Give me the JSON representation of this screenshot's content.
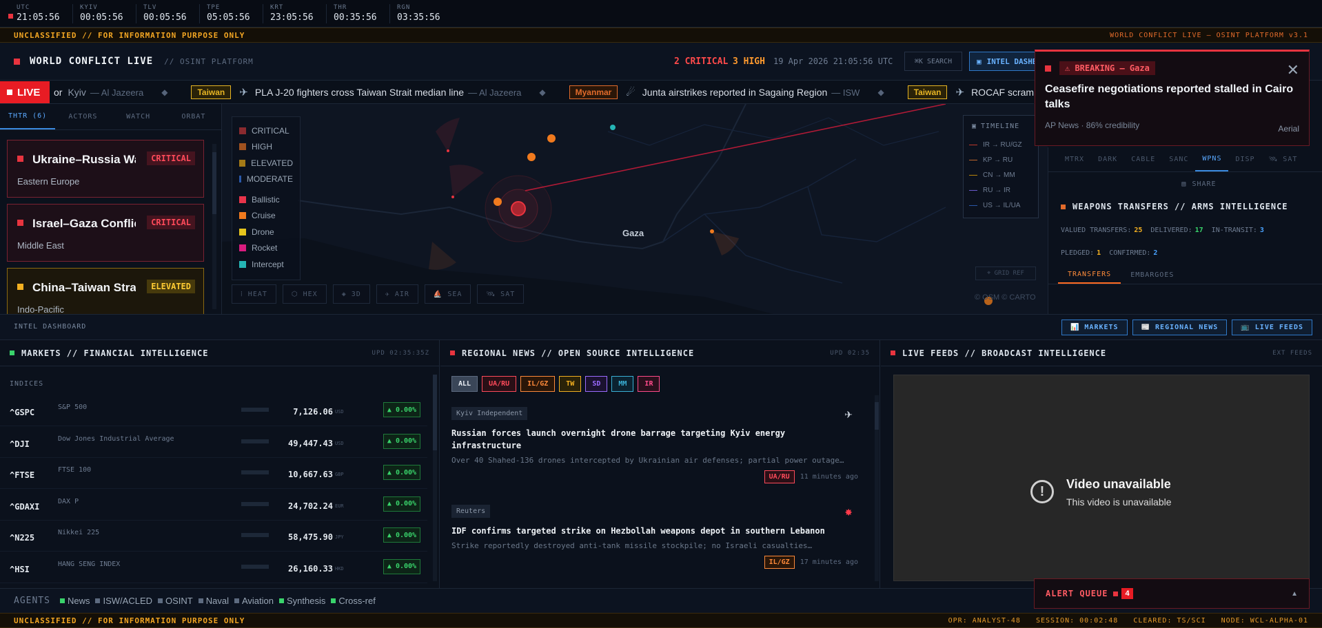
{
  "clock": [
    {
      "zone": "UTC",
      "time": "21:05:56"
    },
    {
      "zone": "KYIV",
      "time": "00:05:56"
    },
    {
      "zone": "TLV",
      "time": "00:05:56"
    },
    {
      "zone": "TPE",
      "time": "05:05:56"
    },
    {
      "zone": "KRT",
      "time": "23:05:56"
    },
    {
      "zone": "THR",
      "time": "00:35:56"
    },
    {
      "zone": "RGN",
      "time": "03:35:56"
    }
  ],
  "classification": {
    "banner": "UNCLASSIFIED // FOR INFORMATION PURPOSE ONLY",
    "platform": "WORLD CONFLICT LIVE — OSINT PLATFORM v3.1"
  },
  "header": {
    "brand": "WORLD CONFLICT LIVE",
    "subtitle": "// OSINT PLATFORM",
    "critical": "2 CRITICAL",
    "high": "3 HIGH",
    "datetime": "19 Apr 2026 21:05:56 UTC",
    "search": "⌘K SEARCH",
    "intel": "INTEL DASHBOARD"
  },
  "ticker": {
    "live": "LIVE",
    "items": [
      {
        "tag": "",
        "headline": "or",
        "extra": "Kyiv",
        "source": "— Al Jazeera",
        "icon": "",
        "color": ""
      },
      {
        "tag": "Taiwan",
        "headline": "PLA J-20 fighters cross Taiwan Strait median line",
        "source": "— Al Jazeera",
        "icon": "✈",
        "color": "#e7b524"
      },
      {
        "tag": "Myanmar",
        "headline": "Junta airstrikes reported in Sagaing Region",
        "source": "— ISW",
        "icon": "☄",
        "color": "#e26b2b"
      },
      {
        "tag": "Taiwan",
        "headline": "ROCAF scrambles jets",
        "source": "",
        "icon": "✈",
        "color": "#e7b524"
      }
    ]
  },
  "left": {
    "tabs": [
      "THTR (6)",
      "ACTORS",
      "WATCH",
      "ORBAT"
    ],
    "cards": [
      {
        "title": "Ukraine–Russia War",
        "badge": "CRITICAL",
        "region": "Eastern Europe",
        "level": "crit"
      },
      {
        "title": "Israel–Gaza Conflict",
        "badge": "CRITICAL",
        "region": "Middle East",
        "level": "crit"
      },
      {
        "title": "China–Taiwan Strait",
        "badge": "ELEVATED",
        "region": "Indo-Pacific",
        "level": "elev"
      }
    ]
  },
  "map": {
    "legend": [
      {
        "label": "CRITICAL",
        "color": "#8a2a2f"
      },
      {
        "label": "HIGH",
        "color": "#a0521f"
      },
      {
        "label": "ELEVATED",
        "color": "#a47a16"
      },
      {
        "label": "MODERATE",
        "color": "#2a58a8"
      },
      {
        "label": "Ballistic",
        "color": "#e8344a"
      },
      {
        "label": "Cruise",
        "color": "#f07a1e"
      },
      {
        "label": "Drone",
        "color": "#e6c51d"
      },
      {
        "label": "Rocket",
        "color": "#d91c7f"
      },
      {
        "label": "Intercept",
        "color": "#25b5b5"
      }
    ],
    "buttons": [
      "⁞ HEAT",
      "⬡ HEX",
      "◈ 3D",
      "✈ AIR",
      "⛵ SEA",
      "🛰 SAT"
    ],
    "place": "Gaza",
    "attribution": "© OSM © CARTO",
    "grid_ref": "⌖ GRID REF",
    "timeline": {
      "title": "TIMELINE",
      "items": [
        {
          "label": "IR → RU/GZ",
          "color": "#c0392b"
        },
        {
          "label": "KP → RU",
          "color": "#c0662b"
        },
        {
          "label": "CN → MM",
          "color": "#b8860b"
        },
        {
          "label": "RU → IR",
          "color": "#6a5acd"
        },
        {
          "label": "US → IL/UA",
          "color": "#2a58a8"
        }
      ]
    }
  },
  "breaking": {
    "label": "⚠ BREAKING — Gaza",
    "headline": "Ceasefire negotiations reported stalled in Cairo talks",
    "meta": "AP News · 86% credibility",
    "type": "Aerial"
  },
  "right": {
    "tabs": [
      "MTRX",
      "DARK",
      "CABLE",
      "SANC",
      "WPNS",
      "DISP",
      "🛰 SAT"
    ],
    "share": "SHARE",
    "title": "WEAPONS TRANSFERS // ARMS INTELLIGENCE",
    "stats": [
      {
        "label": "VALUED TRANSFERS:",
        "value": "25",
        "color": "#f3b021"
      },
      {
        "label": "DELIVERED:",
        "value": "17",
        "color": "#39d36b"
      },
      {
        "label": "IN-TRANSIT:",
        "value": "3",
        "color": "#4aa3ff"
      }
    ],
    "stats2": [
      {
        "label": "PLEDGED:",
        "value": "1",
        "color": "#f3b021"
      },
      {
        "label": "CONFIRMED:",
        "value": "2",
        "color": "#4aa3ff"
      }
    ],
    "subtabs": [
      "TRANSFERS",
      "EMBARGOES"
    ]
  },
  "dashboard": {
    "title": "INTEL DASHBOARD",
    "buttons": [
      "📊 MARKETS",
      "📰 REGIONAL NEWS",
      "📺 LIVE FEEDS"
    ]
  },
  "markets": {
    "title": "MARKETS // FINANCIAL INTELLIGENCE",
    "updated": "UPD 02:35:35Z",
    "section": "INDICES",
    "rows": [
      {
        "symbol": "^GSPC",
        "name": "S&P 500",
        "price": "7,126.06",
        "cur": "USD",
        "change": "▲ 0.00%"
      },
      {
        "symbol": "^DJI",
        "name": "Dow Jones Industrial Average",
        "price": "49,447.43",
        "cur": "USD",
        "change": "▲ 0.00%"
      },
      {
        "symbol": "^FTSE",
        "name": "FTSE 100",
        "price": "10,667.63",
        "cur": "GBP",
        "change": "▲ 0.00%"
      },
      {
        "symbol": "^GDAXI",
        "name": "DAX P",
        "price": "24,702.24",
        "cur": "EUR",
        "change": "▲ 0.00%"
      },
      {
        "symbol": "^N225",
        "name": "Nikkei 225",
        "price": "58,475.90",
        "cur": "JPY",
        "change": "▲ 0.00%"
      },
      {
        "symbol": "^HSI",
        "name": "HANG SENG INDEX",
        "price": "26,160.33",
        "cur": "HKD",
        "change": "▲ 0.00%"
      }
    ]
  },
  "news": {
    "title": "REGIONAL NEWS // OPEN SOURCE INTELLIGENCE",
    "updated": "UPD 02:35",
    "filters": [
      {
        "label": "ALL",
        "color": "#c8d1dd",
        "bg": "#3a4658"
      },
      {
        "label": "UA/RU",
        "color": "#ff4a5a",
        "bg": "#2a0f16"
      },
      {
        "label": "IL/GZ",
        "color": "#ff8a3a",
        "bg": "#2a1608"
      },
      {
        "label": "TW",
        "color": "#f3b021",
        "bg": "#2a2208"
      },
      {
        "label": "SD",
        "color": "#9b6bff",
        "bg": "#1b1230"
      },
      {
        "label": "MM",
        "color": "#3ab0d6",
        "bg": "#0b2230"
      },
      {
        "label": "IR",
        "color": "#ff4a8a",
        "bg": "#2a0f1c"
      }
    ],
    "items": [
      {
        "source": "Kyiv Independent",
        "icon": "✈",
        "headline": "Russian forces launch overnight drone barrage targeting Kyiv energy infrastructure",
        "desc": "Over 40 Shahed-136 drones intercepted by Ukrainian air defenses; partial power outage…",
        "tag": "UA/RU",
        "tagcolor": "#ff4a5a",
        "time": "11 minutes ago"
      },
      {
        "source": "Reuters",
        "icon": "✸",
        "headline": "IDF confirms targeted strike on Hezbollah weapons depot in southern Lebanon",
        "desc": "Strike reportedly destroyed anti-tank missile stockpile; no Israeli casualties…",
        "tag": "IL/GZ",
        "tagcolor": "#ff8a3a",
        "time": "17 minutes ago"
      }
    ]
  },
  "feeds": {
    "title": "LIVE FEEDS // BROADCAST INTELLIGENCE",
    "ext": "EXT FEEDS",
    "video_title": "Video unavailable",
    "video_sub": "This video is unavailable"
  },
  "agents": {
    "label": "AGENTS",
    "items": [
      {
        "label": "News",
        "color": "#39d36b"
      },
      {
        "label": "ISW/ACLED",
        "color": "#5d6b80"
      },
      {
        "label": "OSINT",
        "color": "#5d6b80"
      },
      {
        "label": "Naval",
        "color": "#5d6b80"
      },
      {
        "label": "Aviation",
        "color": "#5d6b80"
      },
      {
        "label": "Synthesis",
        "color": "#39d36b"
      },
      {
        "label": "Cross-ref",
        "color": "#39d36b"
      }
    ]
  },
  "alertq": {
    "label": "ALERT QUEUE",
    "count": "4"
  },
  "footer": {
    "opr": "OPR: ANALYST-48",
    "session": "SESSION: 00:02:48",
    "cleared": "CLEARED: TS/SCI",
    "node": "NODE: WCL-ALPHA-01"
  }
}
